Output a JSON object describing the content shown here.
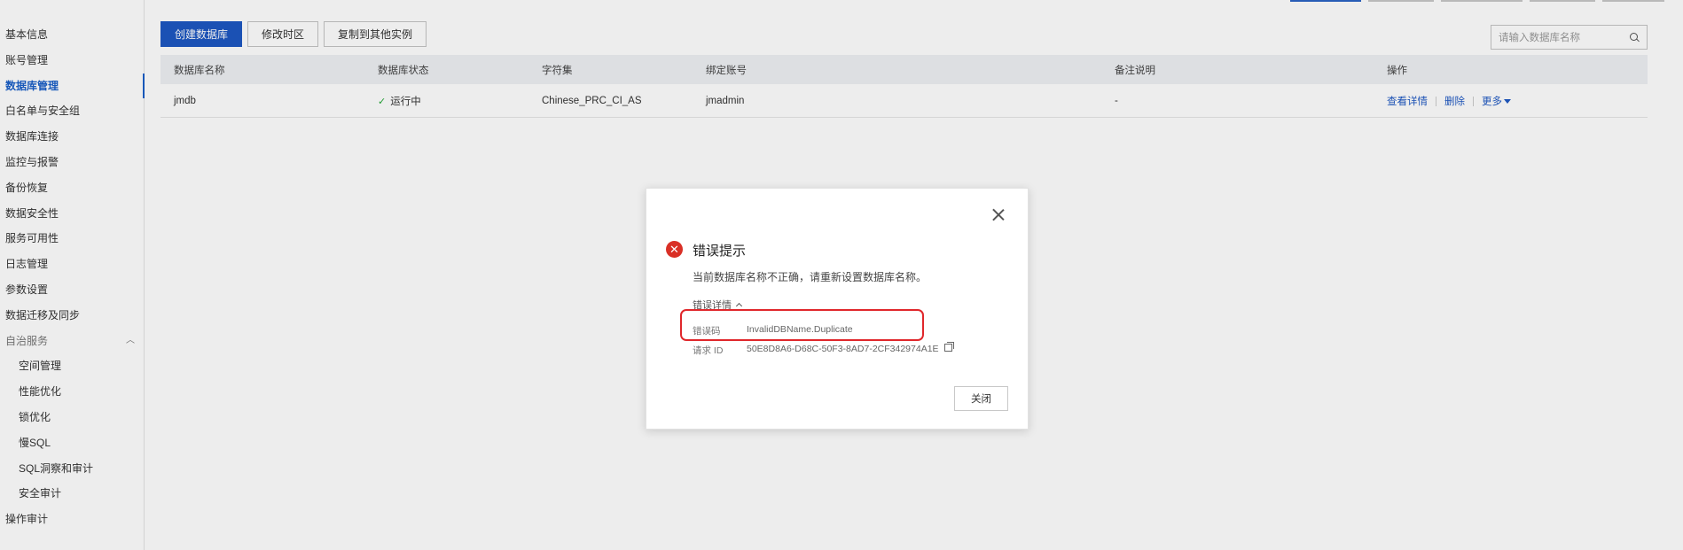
{
  "sidebar": {
    "items": [
      {
        "label": "基本信息"
      },
      {
        "label": "账号管理"
      },
      {
        "label": "数据库管理"
      },
      {
        "label": "白名单与安全组"
      },
      {
        "label": "数据库连接"
      },
      {
        "label": "监控与报警"
      },
      {
        "label": "备份恢复"
      },
      {
        "label": "数据安全性"
      },
      {
        "label": "服务可用性"
      },
      {
        "label": "日志管理"
      },
      {
        "label": "参数设置"
      },
      {
        "label": "数据迁移及同步"
      }
    ],
    "group": {
      "label": "自治服务",
      "children": [
        {
          "label": "空间管理"
        },
        {
          "label": "性能优化"
        },
        {
          "label": "锁优化"
        },
        {
          "label": "慢SQL"
        },
        {
          "label": "SQL洞察和审计"
        },
        {
          "label": "安全审计"
        }
      ]
    },
    "last": {
      "label": "操作审计"
    },
    "active_color": "#1a5fc8"
  },
  "toolbar": {
    "create_label": "创建数据库",
    "timezone_label": "修改时区",
    "copy_label": "复制到其他实例",
    "search_placeholder": "请输入数据库名称"
  },
  "table": {
    "headers": [
      "数据库名称",
      "数据库状态",
      "字符集",
      "绑定账号",
      "备注说明",
      "操作"
    ],
    "rows": [
      {
        "name": "jmdb",
        "status": "运行中",
        "charset": "Chinese_PRC_CI_AS",
        "account": "jmadmin",
        "remark": "-",
        "actions": {
          "detail": "查看详情",
          "delete": "删除",
          "more": "更多"
        }
      }
    ]
  },
  "dialog": {
    "title": "错误提示",
    "message": "当前数据库名称不正确，请重新设置数据库名称。",
    "details_toggle": "错误详情",
    "error_code_label": "错误码",
    "error_code_value": "InvalidDBName.Duplicate",
    "request_id_label": "请求 ID",
    "request_id_value": "50E8D8A6-D68C-50F3-8AD7-2CF342974A1E",
    "close_label": "关闭",
    "error_color": "#d93026",
    "highlight_color": "#e0272b"
  }
}
